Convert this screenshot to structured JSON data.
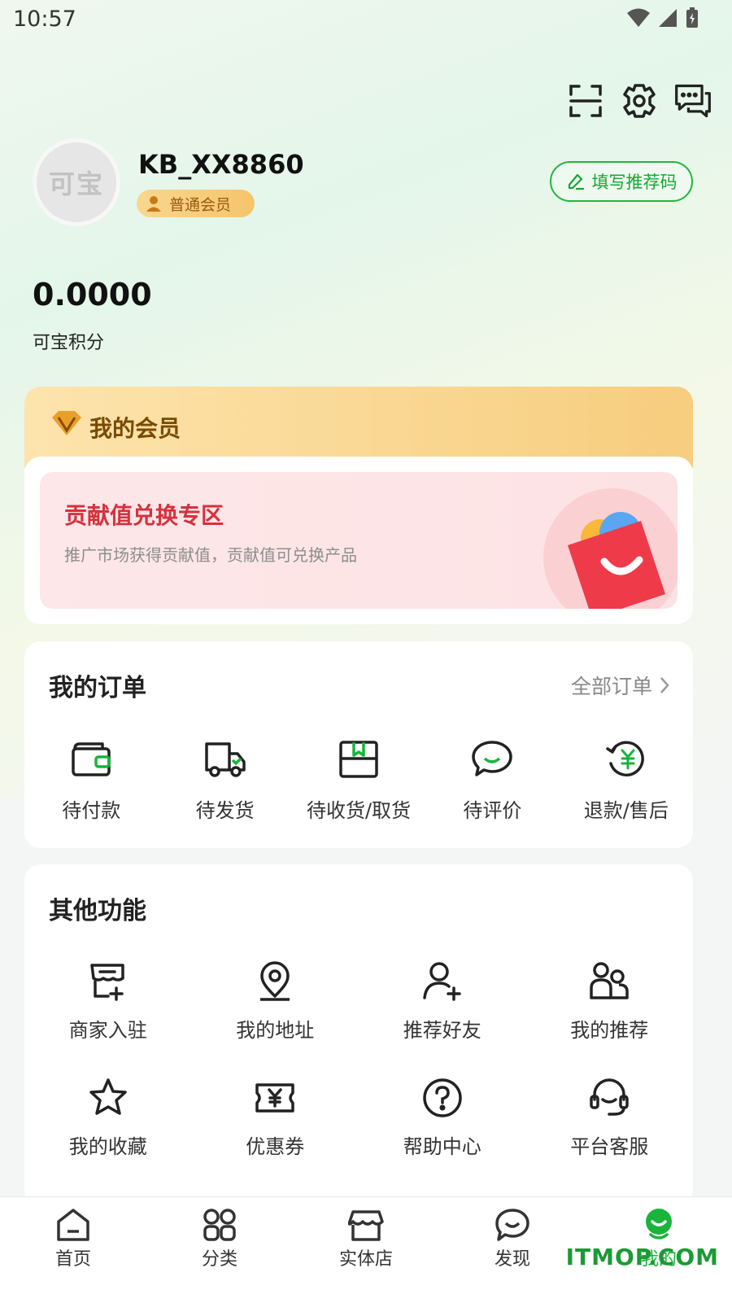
{
  "status_bar": {
    "time": "10:57"
  },
  "profile": {
    "avatar_text": "可宝",
    "username": "KB_XX8860",
    "member_level": "普通会员",
    "referral_button": "填写推荐码"
  },
  "points": {
    "value": "0.0000",
    "label": "可宝积分"
  },
  "membership": {
    "title": "我的会员",
    "exchange_title": "贡献值兑换专区",
    "exchange_desc": "推广市场获得贡献值，贡献值可兑换产品"
  },
  "orders": {
    "title": "我的订单",
    "all_label": "全部订单",
    "items": [
      {
        "label": "待付款",
        "icon": "wallet-icon"
      },
      {
        "label": "待发货",
        "icon": "truck-icon"
      },
      {
        "label": "待收货/取货",
        "icon": "package-icon"
      },
      {
        "label": "待评价",
        "icon": "comment-icon"
      },
      {
        "label": "退款/售后",
        "icon": "refund-icon"
      }
    ]
  },
  "functions": {
    "title": "其他功能",
    "items": [
      {
        "label": "商家入驻",
        "icon": "store-add-icon"
      },
      {
        "label": "我的地址",
        "icon": "location-icon"
      },
      {
        "label": "推荐好友",
        "icon": "user-add-icon"
      },
      {
        "label": "我的推荐",
        "icon": "users-icon"
      },
      {
        "label": "我的收藏",
        "icon": "star-icon"
      },
      {
        "label": "优惠券",
        "icon": "coupon-icon"
      },
      {
        "label": "帮助中心",
        "icon": "help-icon"
      },
      {
        "label": "平台客服",
        "icon": "headset-icon"
      }
    ]
  },
  "nav": {
    "items": [
      {
        "label": "首页",
        "icon": "home-icon"
      },
      {
        "label": "分类",
        "icon": "category-icon"
      },
      {
        "label": "实体店",
        "icon": "shop-icon"
      },
      {
        "label": "发现",
        "icon": "discover-icon"
      },
      {
        "label": "我的",
        "icon": "profile-icon"
      }
    ],
    "active": "我的"
  },
  "watermark": "ITMOP.COM",
  "colors": {
    "accent": "#19b43a",
    "member_gold": "#f7cd7e",
    "exchange_red": "#d6313d"
  }
}
